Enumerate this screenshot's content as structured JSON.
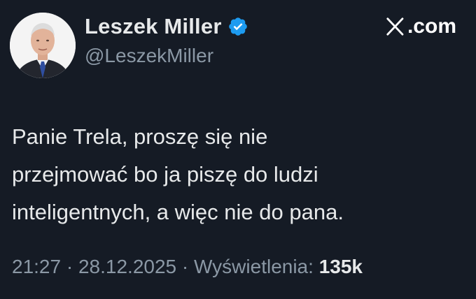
{
  "author": {
    "display_name": "Leszek Miller",
    "handle": "@LeszekMiller",
    "verified_icon": "verified-badge-icon",
    "verified_color": "#1d9bf0"
  },
  "brand": {
    "label": ".com",
    "icon": "x-logo-icon"
  },
  "tweet": {
    "lines": [
      "Panie Trela, proszę się nie",
      "przejmować bo ja piszę do ludzi",
      "inteligentnych, a więc nie do pana."
    ]
  },
  "meta": {
    "time": "21:27",
    "separator": " · ",
    "date": "28.12.2025",
    "views_label": "Wyświetlenia:",
    "views_count": "135k"
  },
  "colors": {
    "background": "#151b25",
    "primary_text": "#e7e9ea",
    "secondary_text": "#8b98a5"
  }
}
